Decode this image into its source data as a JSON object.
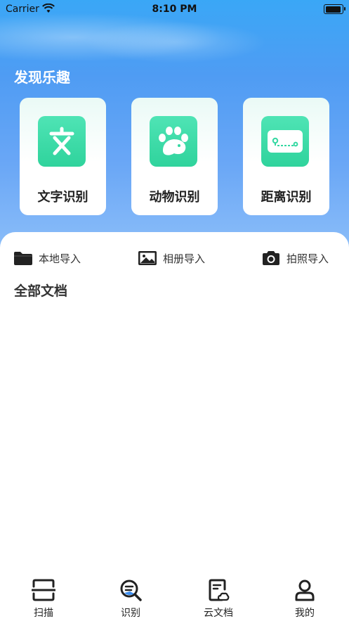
{
  "status_bar": {
    "carrier": "Carrier",
    "time": "8:10 PM"
  },
  "discover": {
    "title": "发现乐趣",
    "cards": [
      {
        "label": "文字识别",
        "icon": "text-recognition-icon"
      },
      {
        "label": "动物识别",
        "icon": "paw-icon"
      },
      {
        "label": "距离识别",
        "icon": "distance-icon"
      }
    ]
  },
  "import_actions": [
    {
      "label": "本地导入",
      "icon": "folder-icon"
    },
    {
      "label": "相册导入",
      "icon": "image-icon"
    },
    {
      "label": "拍照导入",
      "icon": "camera-icon"
    }
  ],
  "documents": {
    "title": "全部文档"
  },
  "tabbar": {
    "tabs": [
      {
        "label": "扫描",
        "icon": "scan-icon"
      },
      {
        "label": "识别",
        "icon": "recognize-icon"
      },
      {
        "label": "云文档",
        "icon": "cloud-document-icon"
      },
      {
        "label": "我的",
        "icon": "profile-icon"
      }
    ]
  },
  "colors": {
    "accent_green": "#34d8a2",
    "hero_blue": "#4f9cf3"
  }
}
